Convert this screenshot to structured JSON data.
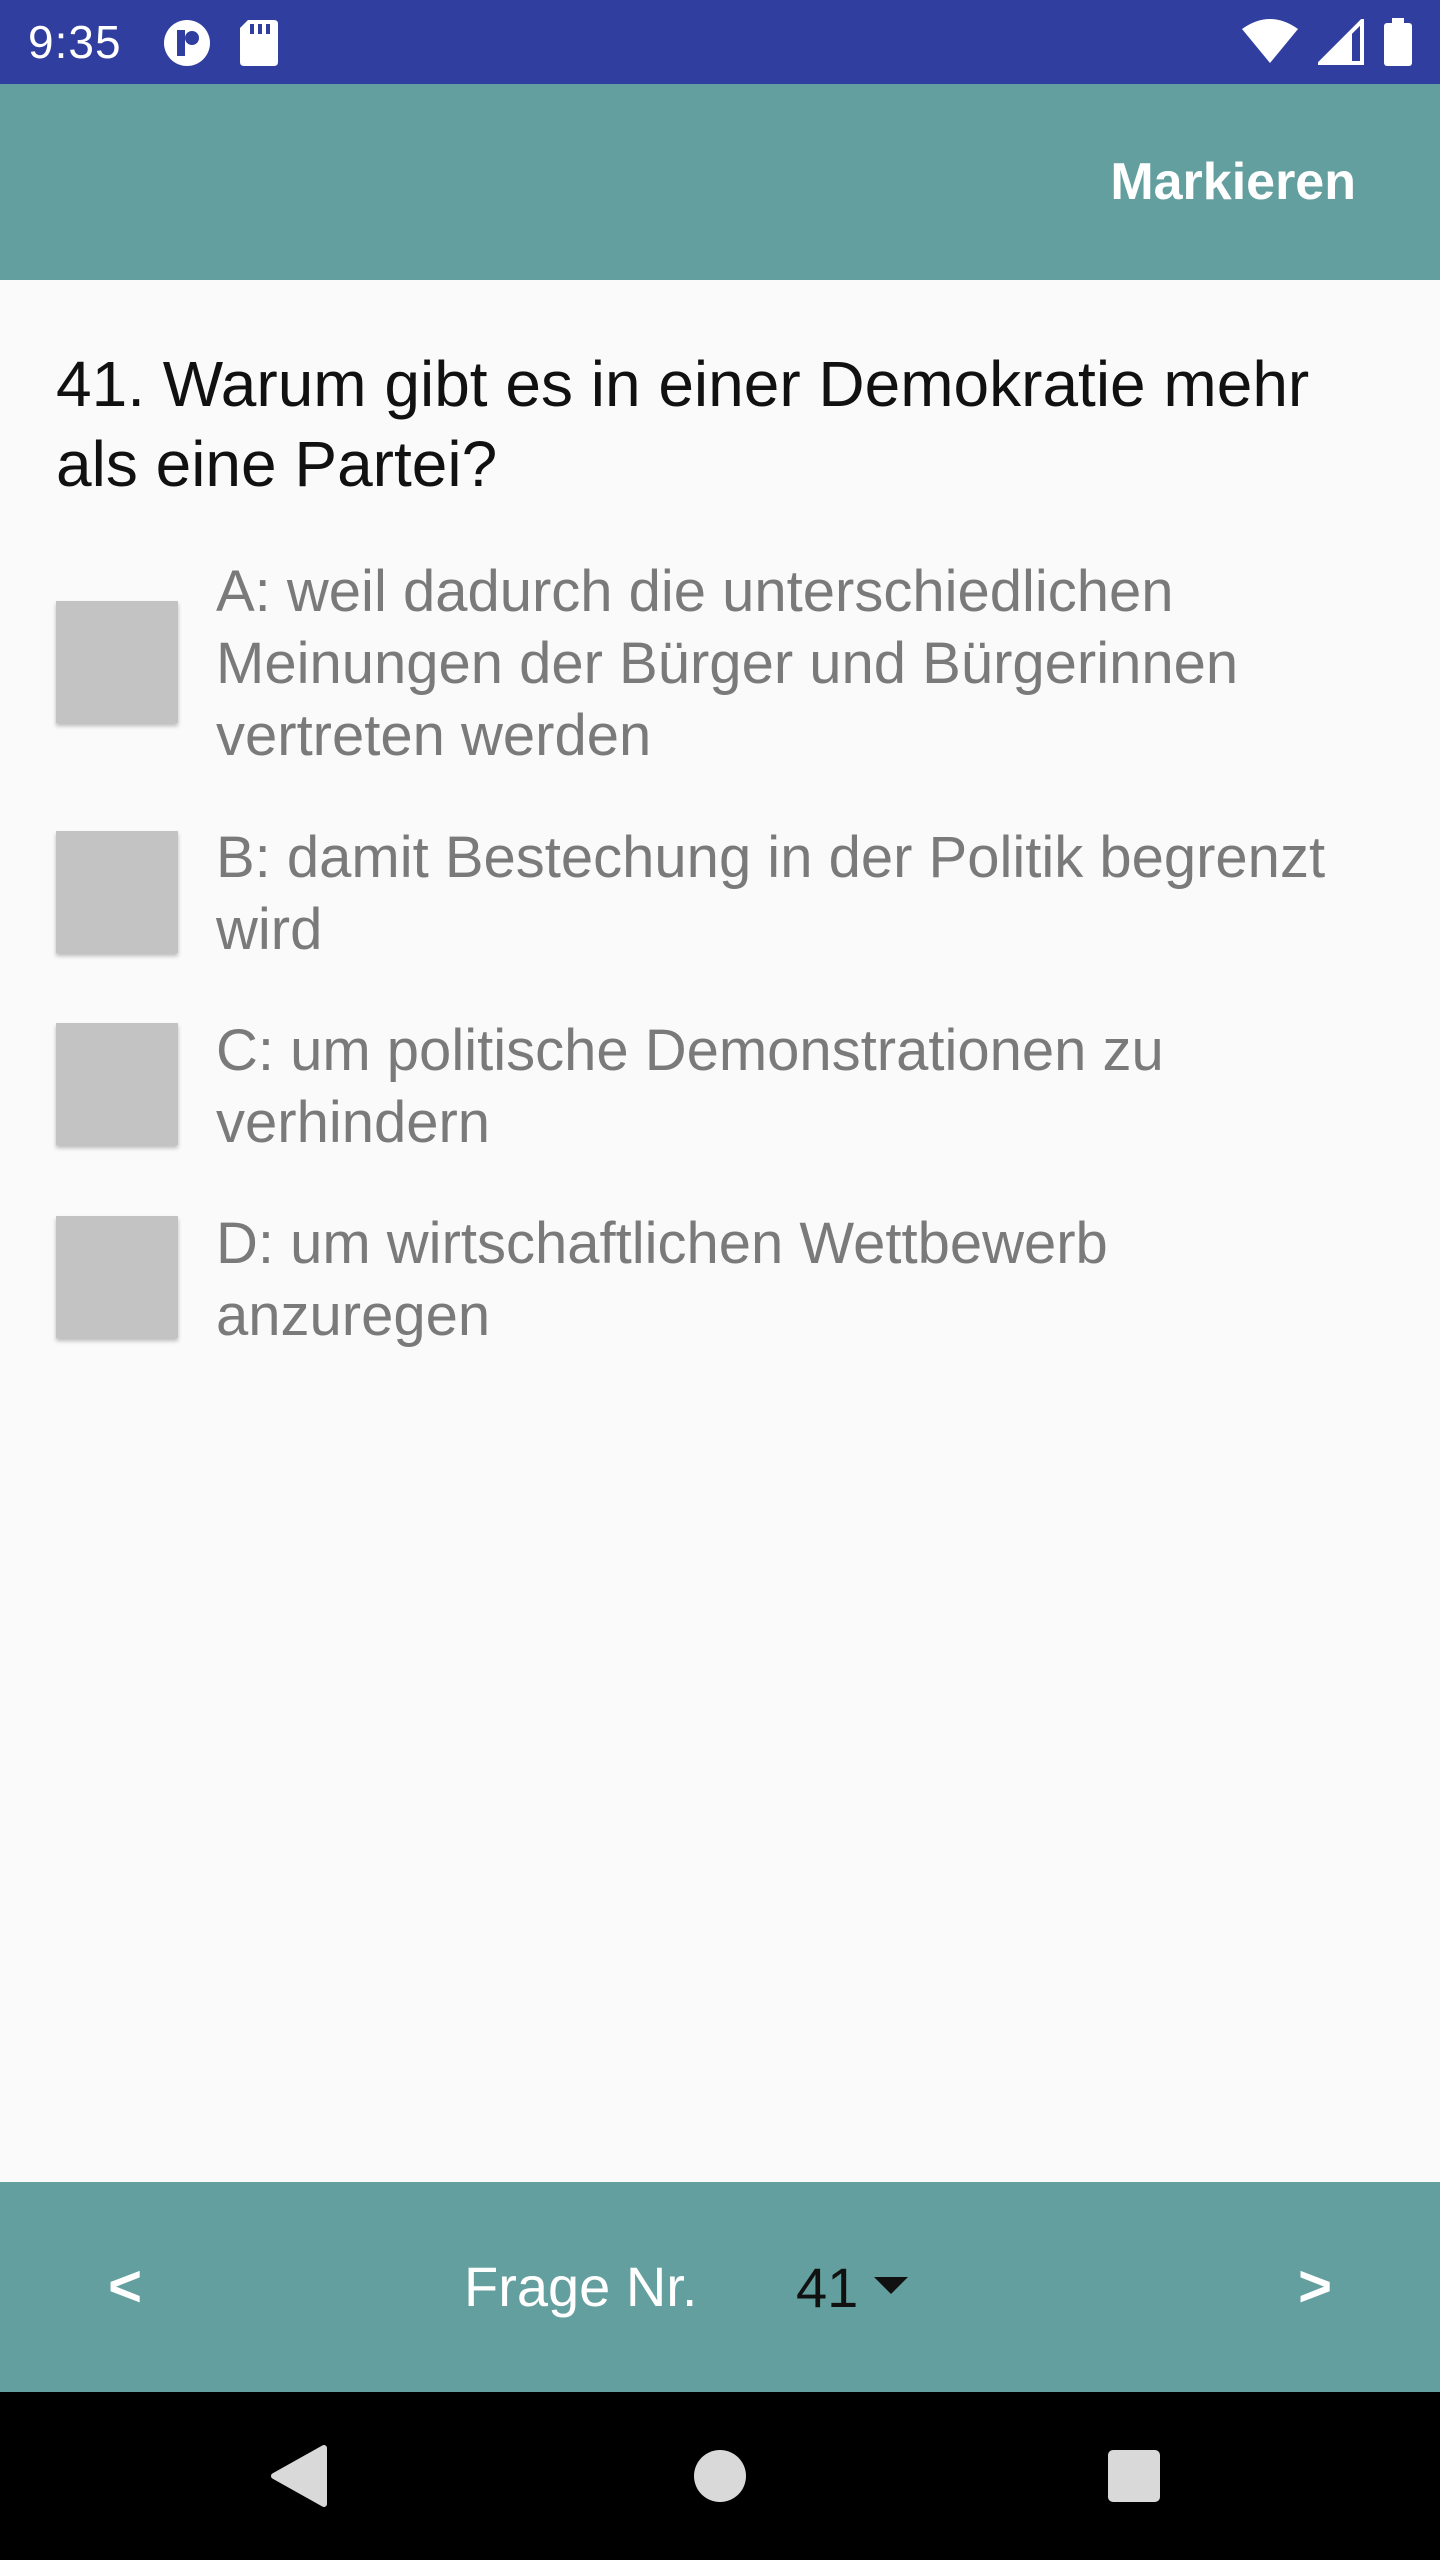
{
  "status_bar": {
    "time": "9:35",
    "background": "#303f9f"
  },
  "app_bar": {
    "mark_label": "Markieren",
    "background": "#639f9e"
  },
  "question": {
    "text": "41. Warum gibt es in einer Demokratie mehr als eine Partei?"
  },
  "answers": [
    {
      "text": "A: weil dadurch die unterschiedlichen Meinungen der Bürger und Bürgerinnen vertreten werden",
      "checked": false
    },
    {
      "text": "B: damit Bestechung in der Politik begrenzt wird",
      "checked": false
    },
    {
      "text": "C: um politische Demonstrationen zu verhindern",
      "checked": false
    },
    {
      "text": "D: um wirtschaftlichen Wettbewerb anzuregen",
      "checked": false
    }
  ],
  "bottom_nav": {
    "prev_label": "<",
    "next_label": ">",
    "question_label": "Frage Nr.",
    "question_number": "41"
  },
  "icons": {
    "status_left": [
      "app-notification-icon",
      "sd-card-icon"
    ],
    "status_right": [
      "wifi-icon",
      "signal-icon",
      "battery-icon"
    ],
    "system_nav": [
      "back-triangle-icon",
      "home-circle-icon",
      "recent-square-icon"
    ]
  }
}
